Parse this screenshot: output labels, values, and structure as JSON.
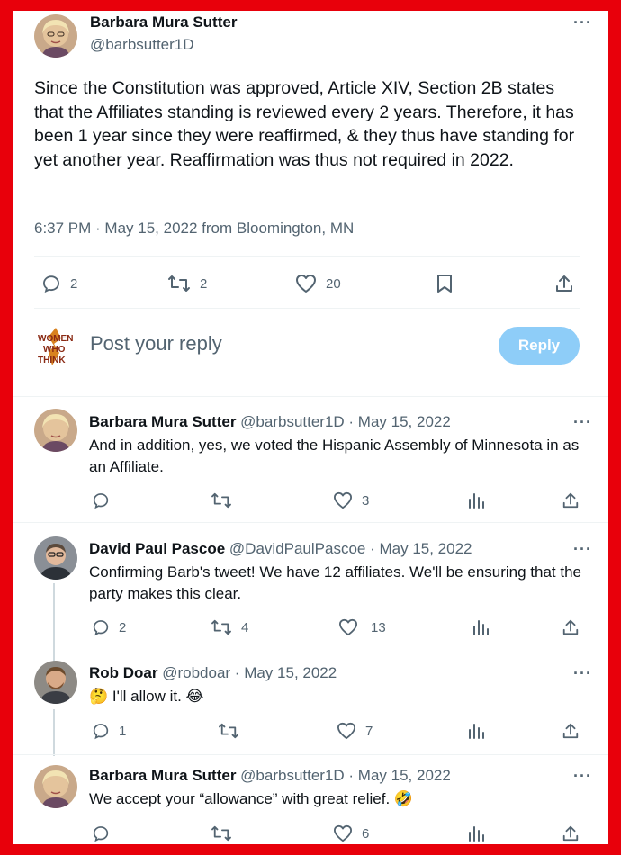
{
  "main_tweet": {
    "author_name": "Barbara Mura Sutter",
    "author_handle": "@barbsutter1D",
    "more": "···",
    "text": "Since the Constitution was approved, Article XIV, Section 2B states that the Affiliates standing is reviewed every 2 years. Therefore, it has been 1 year since they were reaffirmed, & they thus have standing for yet another year. Reaffirmation was thus not required in 2022.",
    "meta": "6:37 PM · May 15, 2022 from Bloomington, MN",
    "replies": "2",
    "retweets": "2",
    "likes": "20"
  },
  "composer": {
    "placeholder": "Post your reply",
    "button": "Reply",
    "avatar_text": "WOMEN WHO THINK"
  },
  "replies": [
    {
      "name": "Barbara Mura Sutter",
      "handle": "@barbsutter1D · May 15, 2022",
      "more": "···",
      "text": "And in addition, yes, we voted the Hispanic Assembly of Minnesota in as an Affiliate.",
      "replies": "",
      "retweets": "",
      "likes": "3"
    },
    {
      "name": "David Paul Pascoe",
      "handle": "@DavidPaulPascoe · May 15, 2022",
      "more": "···",
      "text": "Confirming Barb's tweet! We have 12 affiliates. We'll be ensuring that the party makes this clear.",
      "replies": "2",
      "retweets": "4",
      "likes": "13"
    },
    {
      "name": "Rob Doar",
      "handle": "@robdoar · May 15, 2022",
      "more": "···",
      "text": "🤔 I'll allow it. 😂",
      "replies": "1",
      "retweets": "",
      "likes": "7"
    },
    {
      "name": "Barbara Mura Sutter",
      "handle": "@barbsutter1D · May 15, 2022",
      "more": "···",
      "text": "We accept your “allowance” with great relief. 🤣",
      "replies": "",
      "retweets": "",
      "likes": "6"
    }
  ],
  "colors": {
    "border": "#e8000b",
    "accent": "#1d9bf0",
    "reply_button": "#8ecdf8",
    "secondary_text": "#536471"
  }
}
